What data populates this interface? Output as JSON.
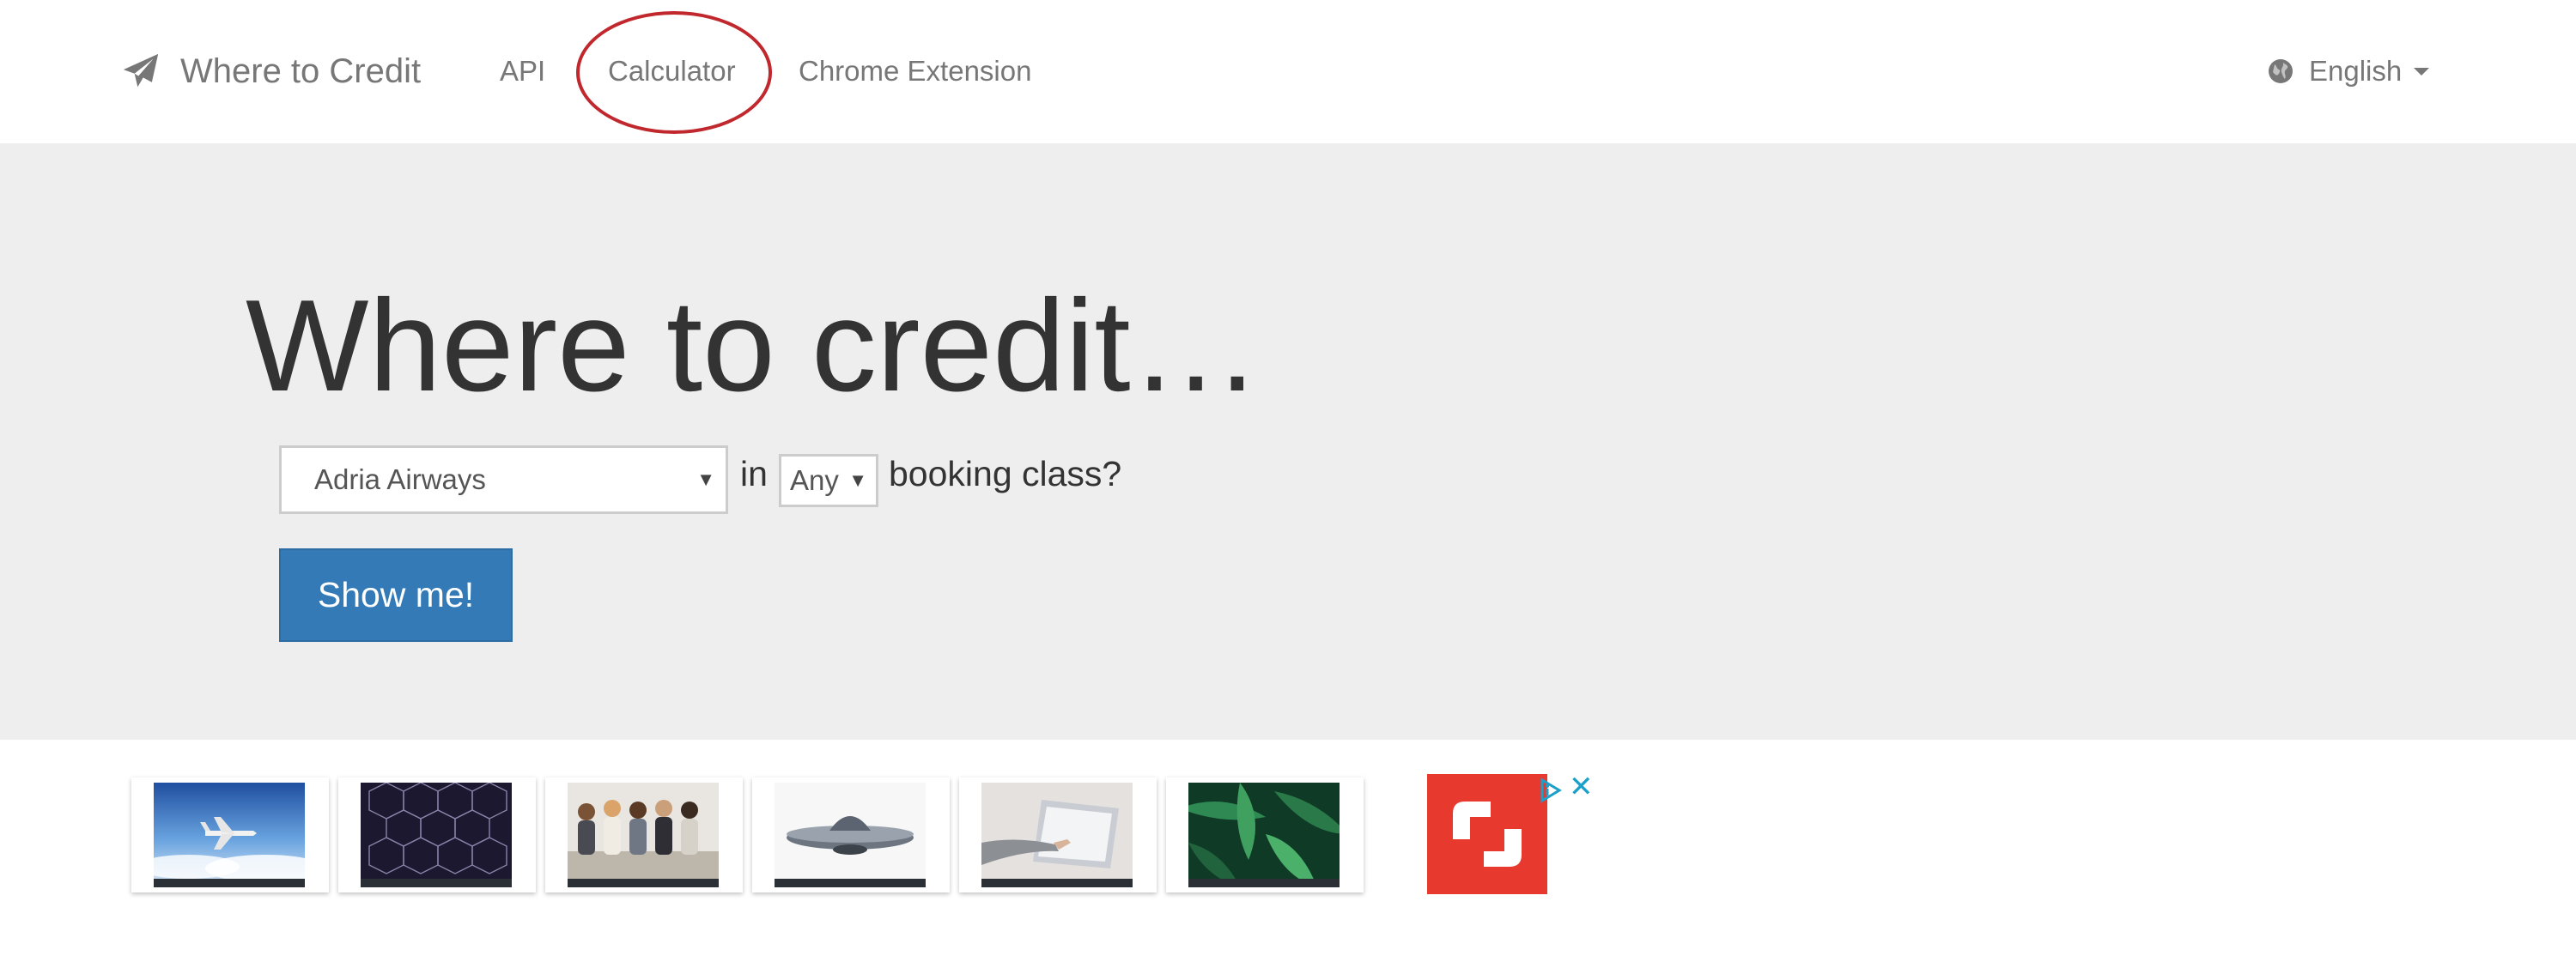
{
  "navbar": {
    "brand": "Where to Credit",
    "links": [
      {
        "label": "API"
      },
      {
        "label": "Calculator"
      },
      {
        "label": "Chrome Extension"
      }
    ],
    "language": "English",
    "icons": {
      "brand": "paper-plane-icon",
      "language": "globe-icon",
      "dropdown": "caret-down-icon"
    }
  },
  "hero": {
    "title": "Where to credit…",
    "airline_select": {
      "value": "Adria Airways"
    },
    "in_label": "in",
    "class_select": {
      "value": "Any"
    },
    "booking_label": "booking class?",
    "submit_label": "Show me!"
  },
  "ads": {
    "cards": [
      {
        "subject": "airplane over clouds"
      },
      {
        "subject": "geometric hexagon pattern"
      },
      {
        "subject": "group of people"
      },
      {
        "subject": "flying saucer"
      },
      {
        "subject": "hand on laptop"
      },
      {
        "subject": "green tropical leaves"
      }
    ],
    "icons": {
      "brand": "shutterstock-logo-icon",
      "info": "adchoices-icon",
      "close": "close-icon"
    }
  },
  "colors": {
    "navbar_bg": "#ffffff",
    "jumbotron_bg": "#eeeeee",
    "primary_button": "#337ab7",
    "annotation": "#c0282d",
    "ad_brand": "#e8392f",
    "ad_accent": "#1ba0c9"
  }
}
